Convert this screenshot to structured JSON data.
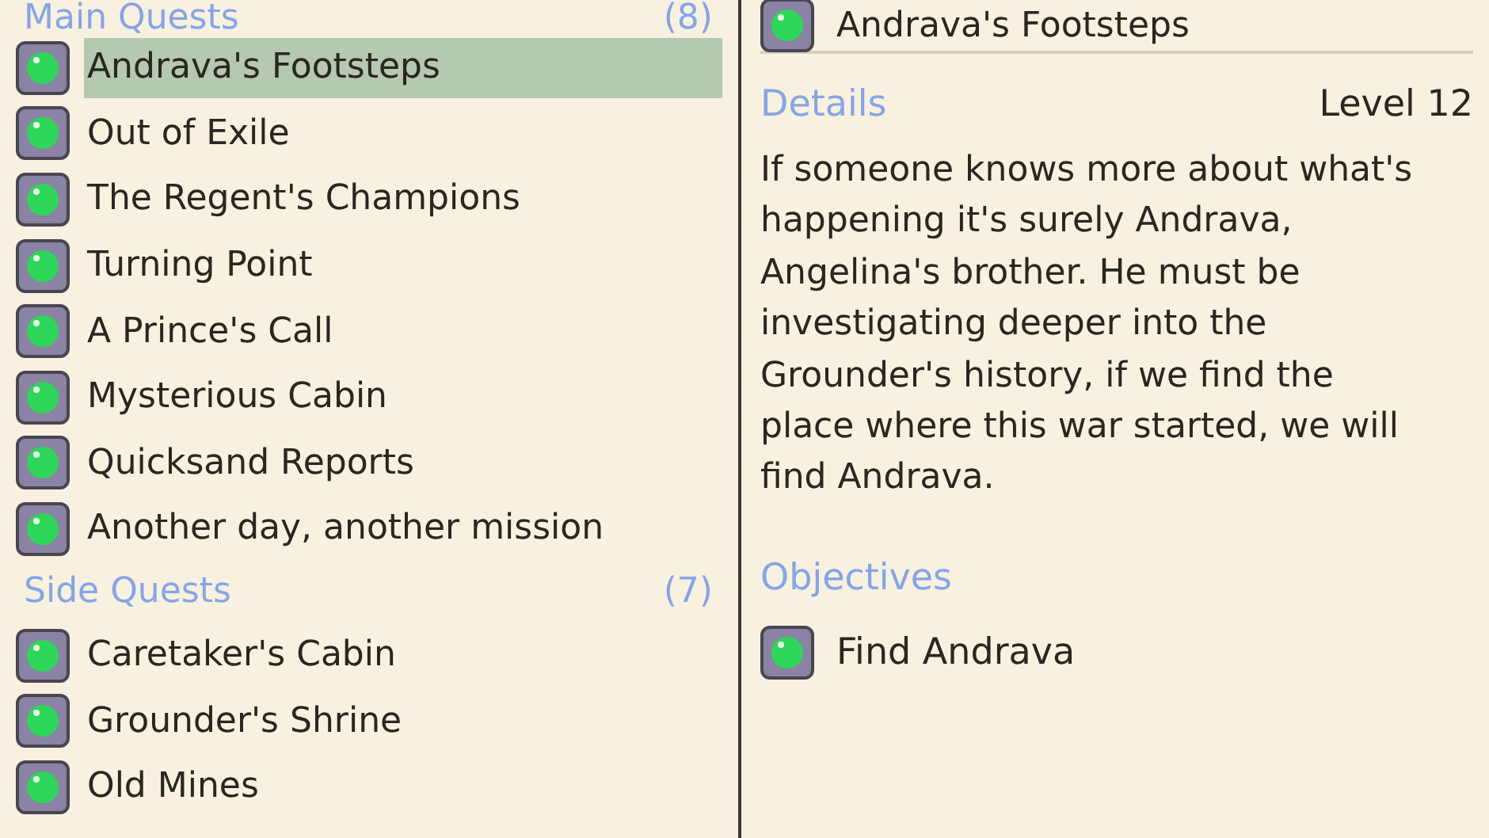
{
  "quest_log": {
    "sections": [
      {
        "title": "Main Quests",
        "count": "(8)",
        "quests": [
          {
            "name": "Andrava's Footsteps",
            "selected": true
          },
          {
            "name": "Out of Exile",
            "selected": false
          },
          {
            "name": "The Regent's Champions",
            "selected": false
          },
          {
            "name": "Turning Point",
            "selected": false
          },
          {
            "name": "A Prince's Call",
            "selected": false
          },
          {
            "name": "Mysterious Cabin",
            "selected": false
          },
          {
            "name": "Quicksand Reports",
            "selected": false
          },
          {
            "name": "Another day, another mission",
            "selected": false
          }
        ]
      },
      {
        "title": "Side Quests",
        "count": "(7)",
        "quests": [
          {
            "name": "Caretaker's Cabin",
            "selected": false
          },
          {
            "name": "Grounder's Shrine",
            "selected": false
          },
          {
            "name": "Old Mines",
            "selected": false
          }
        ]
      }
    ]
  },
  "details": {
    "title": "Andrava's Footsteps",
    "details_heading": "Details",
    "level": "Level 12",
    "description": "If someone knows more about what's happening it's surely Andrava, Angelina's brother. He must be investigating deeper into the Grounder's history, if we find the place where this war started, we will find Andrava.",
    "objectives_heading": "Objectives",
    "objectives": [
      {
        "text": "Find Andrava"
      }
    ]
  }
}
